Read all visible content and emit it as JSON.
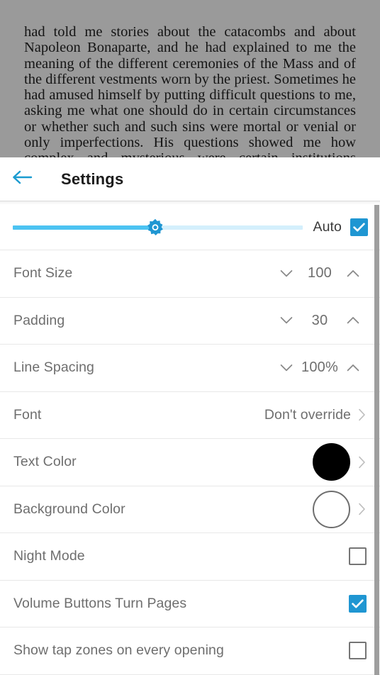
{
  "reader": {
    "passage": "had told me stories about the catacombs and about Napoleon Bonaparte, and he had explained to me the meaning of the different ceremonies of the Mass and of the different vestments worn by the priest. Sometimes he had amused himself by putting difficult questions to me, asking me what one should do in certain circumstances or whether such and such sins were mortal or venial or only imperfections. His questions showed me how complex and mysterious were certain institutions"
  },
  "header": {
    "title": "Settings",
    "back_icon": "arrow-left-icon"
  },
  "brightness": {
    "icon": "brightness-icon",
    "fill_percent": "49",
    "auto_label": "Auto",
    "auto_checked": true
  },
  "rows": [
    {
      "label": "Font Size",
      "type": "stepper",
      "value": "100",
      "decrease_icon": "chevron-down-icon",
      "increase_icon": "chevron-up-icon"
    },
    {
      "label": "Padding",
      "type": "stepper",
      "value": "30",
      "decrease_icon": "chevron-down-icon",
      "increase_icon": "chevron-up-icon"
    },
    {
      "label": "Line Spacing",
      "type": "stepper",
      "value": "100%",
      "decrease_icon": "chevron-down-icon",
      "increase_icon": "chevron-up-icon"
    },
    {
      "label": "Font",
      "type": "navigate",
      "value": "Don't override",
      "chevron_icon": "chevron-right-icon"
    },
    {
      "label": "Text Color",
      "type": "color",
      "swatch_color": "#000000",
      "swatch_border": "#000000",
      "chevron_icon": "chevron-right-icon"
    },
    {
      "label": "Background Color",
      "type": "color",
      "swatch_color": "#ffffff",
      "swatch_border": "#6e6e6e",
      "chevron_icon": "chevron-right-icon"
    },
    {
      "label": "Night Mode",
      "type": "checkbox",
      "checked": false
    },
    {
      "label": "Volume Buttons Turn Pages",
      "type": "checkbox",
      "checked": true
    },
    {
      "label": "Show tap zones on every opening",
      "type": "checkbox",
      "checked": false
    }
  ],
  "colors": {
    "accent": "#1f96d2",
    "back_arrow": "#1a9bd0",
    "slider_fill": "#4cc3f2",
    "slider_track": "#d4effc",
    "label_text": "#6e6e6e",
    "divider": "#e8e8e8",
    "scrollbar": "#9e9e9e",
    "reader_overlay": "#9a9a9a"
  }
}
